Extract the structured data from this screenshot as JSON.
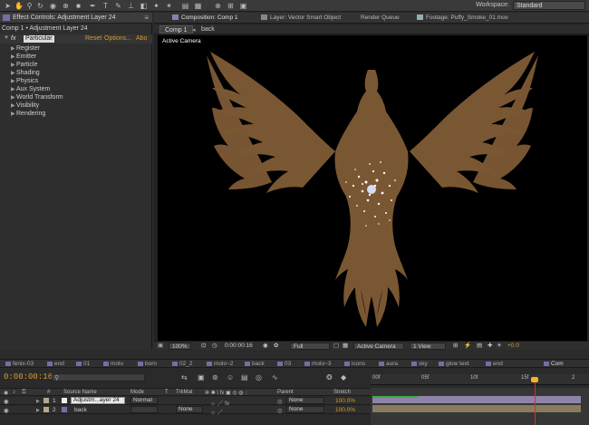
{
  "toolbar": {
    "tools": [
      "selection-tool",
      "hand-tool",
      "zoom-tool",
      "rotation-tool",
      "camera-tool",
      "pan-behind-tool",
      "mask-tool",
      "pen-tool",
      "type-tool",
      "brush-tool",
      "clone-tool",
      "eraser-tool",
      "roto-tool",
      "puppet-tool"
    ],
    "workspace_label": "Workspace:",
    "workspace_value": "Standard"
  },
  "effect_controls": {
    "tab_title": "Effect Controls: Adjustment Layer 24",
    "breadcrumb": "Comp 1 • Adjustment Layer 24",
    "fx_label": "fx",
    "effect_name": "Particular",
    "reset": "Reset",
    "options": "Options...",
    "about": "Abo",
    "properties": [
      "Register",
      "Emitter",
      "Particle",
      "Shading",
      "Physics",
      "Aux System",
      "World Transform",
      "Visibility",
      "Rendering"
    ]
  },
  "composition": {
    "tabs": [
      {
        "label": "Composition: Comp 1",
        "active": true
      },
      {
        "label": "Layer: Vector Smart Object",
        "active": false
      },
      {
        "label": "Render Queue",
        "active": false
      },
      {
        "label": "Footage: Puffy_Smoke_01.mov",
        "active": false
      }
    ],
    "sub_tab": "Comp 1",
    "sub_arrow": "◂",
    "sub_breadcrumb": "back",
    "viewer_label": "Active Camera",
    "bottom": {
      "zoom": "100%",
      "timecode": "0:00:00:16",
      "resolution": "Full",
      "camera": "Active Camera",
      "views": "1 View",
      "exposure": "+0.0"
    },
    "colors": {
      "eagle": "#7a5733",
      "particle": "#ffffff"
    }
  },
  "timeline_tabs": [
    "fenix-03",
    "end",
    "01",
    "molo",
    "born",
    "02_2",
    "molo~2",
    "back",
    "03",
    "molo~3",
    "icons",
    "aura",
    "sky",
    "glow text",
    "end",
    "Com"
  ],
  "timeline": {
    "timecode": "0:00:00:16",
    "ruler_labels": [
      "00f",
      "05f",
      "10f",
      "15f",
      "2"
    ],
    "columns": {
      "num": "#",
      "source": "Source Name",
      "mode": "Mode",
      "t": "T",
      "trkmat": "TrkMat",
      "parent": "Parent",
      "stretch": "Stretch"
    },
    "layers": [
      {
        "num": "1",
        "name": "Adjustm...ayer 24",
        "mode": "Normal",
        "trkmat": "",
        "parent": "None",
        "stretch": "100.0%"
      },
      {
        "num": "2",
        "name": "back",
        "mode": "",
        "trkmat": "None",
        "parent": "None",
        "stretch": "100.0%"
      }
    ],
    "playhead_frame": 16
  }
}
